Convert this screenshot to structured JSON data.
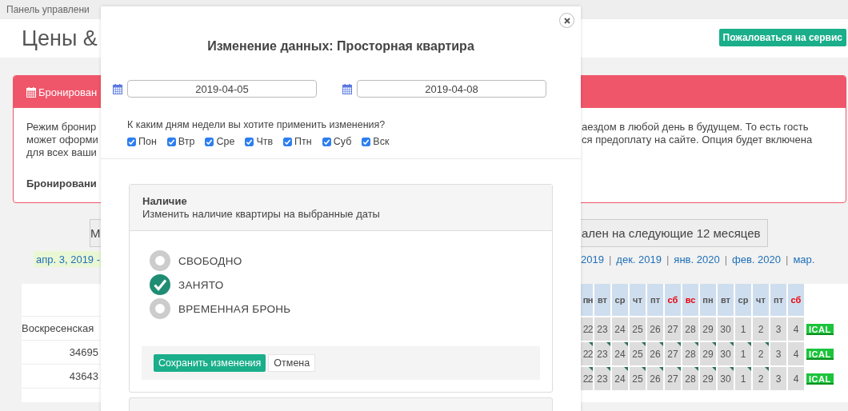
{
  "top_bar": {
    "breadcrumb": "Панель управлени"
  },
  "header": {
    "title": "Цены &",
    "complain_button": "Пожаловаться на сервис"
  },
  "booking_panel": {
    "title": "Бронирован",
    "text_left": [
      "Режим бронир",
      "может оформи",
      "для всех ваши"
    ],
    "text_right": [
      "аездом в любой день в будущем. То есть гость",
      "ся предоплату на сайте. Опция будет включена"
    ],
    "bold_left": "Бронировани"
  },
  "range_buttons": [
    "М",
    "ален на следующие 12 месяцев"
  ],
  "month_links": {
    "current": "апр. 3, 2019 -",
    "links": [
      "2019",
      "дек. 2019",
      "янв. 2020",
      "фев. 2020",
      "мар."
    ],
    "separators": [
      "|",
      "|",
      "|",
      "|"
    ]
  },
  "listing_table": {
    "rows": [
      "Воскресенская",
      "34695",
      "43643"
    ]
  },
  "calendar": {
    "days": [
      {
        "label": "пн",
        "weekend": false
      },
      {
        "label": "вт",
        "weekend": false
      },
      {
        "label": "ср",
        "weekend": false
      },
      {
        "label": "чт",
        "weekend": false
      },
      {
        "label": "пт",
        "weekend": false
      },
      {
        "label": "сб",
        "weekend": true
      },
      {
        "label": "вс",
        "weekend": true
      },
      {
        "label": "пн",
        "weekend": false
      },
      {
        "label": "вт",
        "weekend": false
      },
      {
        "label": "ср",
        "weekend": false
      },
      {
        "label": "чт",
        "weekend": false
      },
      {
        "label": "пт",
        "weekend": false
      },
      {
        "label": "сб",
        "weekend": true
      }
    ],
    "rows": [
      {
        "ical": "ICAL",
        "cells": [
          {
            "date": "22",
            "marked": false
          },
          {
            "date": "23",
            "marked": false
          },
          {
            "date": "24",
            "marked": false
          },
          {
            "date": "25",
            "marked": false
          },
          {
            "date": "26",
            "marked": false
          },
          {
            "date": "27",
            "marked": false
          },
          {
            "date": "28",
            "marked": false
          },
          {
            "date": "29",
            "marked": false
          },
          {
            "date": "30",
            "marked": false
          },
          {
            "date": "1",
            "marked": false
          },
          {
            "date": "2",
            "marked": false
          },
          {
            "date": "3",
            "marked": false
          },
          {
            "date": "4",
            "marked": false
          }
        ]
      },
      {
        "ical": "ICAL",
        "cells": [
          {
            "date": "22",
            "marked": true
          },
          {
            "date": "23",
            "marked": true
          },
          {
            "date": "24",
            "marked": true
          },
          {
            "date": "25",
            "marked": true
          },
          {
            "date": "26",
            "marked": true
          },
          {
            "date": "27",
            "marked": true
          },
          {
            "date": "28",
            "marked": true
          },
          {
            "date": "29",
            "marked": true
          },
          {
            "date": "30",
            "marked": true
          },
          {
            "date": "1",
            "marked": true
          },
          {
            "date": "2",
            "marked": true
          },
          {
            "date": "3",
            "marked": false
          },
          {
            "date": "4",
            "marked": false
          }
        ]
      },
      {
        "ical": "ICAL",
        "cells": [
          {
            "date": "22",
            "marked": true
          },
          {
            "date": "23",
            "marked": true
          },
          {
            "date": "24",
            "marked": true
          },
          {
            "date": "25",
            "marked": true
          },
          {
            "date": "26",
            "marked": true
          },
          {
            "date": "27",
            "marked": true
          },
          {
            "date": "28",
            "marked": true
          },
          {
            "date": "29",
            "marked": true
          },
          {
            "date": "30",
            "marked": true
          },
          {
            "date": "1",
            "marked": true
          },
          {
            "date": "2",
            "marked": true
          },
          {
            "date": "3",
            "marked": false
          },
          {
            "date": "4",
            "marked": false
          }
        ]
      }
    ]
  },
  "modal": {
    "title": "Изменение данных: Просторная квартира",
    "date_from": "2019-04-05",
    "date_to": "2019-04-08",
    "weekday_question": "К каким дням недели вы хотите применить изменения?",
    "weekdays": [
      {
        "label": "Пон",
        "checked": true
      },
      {
        "label": "Втр",
        "checked": true
      },
      {
        "label": "Сре",
        "checked": true
      },
      {
        "label": "Чтв",
        "checked": true
      },
      {
        "label": "Птн",
        "checked": true
      },
      {
        "label": "Суб",
        "checked": true
      },
      {
        "label": "Вск",
        "checked": true
      }
    ],
    "availability": {
      "title": "Наличие",
      "subtitle": "Изменить наличие квартиры на выбранные даты",
      "options": [
        {
          "label": "СВОБОДНО",
          "selected": false
        },
        {
          "label": "ЗАНЯТО",
          "selected": true
        },
        {
          "label": "ВРЕМЕННАЯ БРОНЬ",
          "selected": false
        }
      ],
      "save_button": "Сохранить изменения",
      "cancel_button": "Отмена"
    }
  }
}
